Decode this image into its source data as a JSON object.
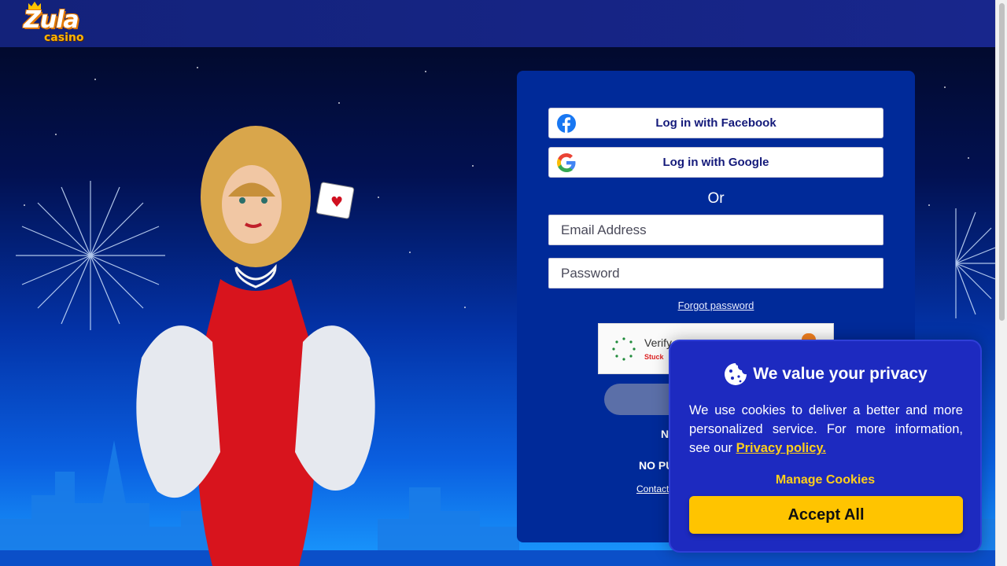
{
  "header": {
    "logo_main": "Zula",
    "logo_sub": "casino"
  },
  "login": {
    "facebook_label": "Log in with Facebook",
    "google_label": "Log in with Google",
    "or_text": "Or",
    "email_placeholder": "Email Address",
    "password_placeholder": "Password",
    "forgot_label": "Forgot password",
    "captcha_verify": "Verify",
    "captcha_stuck": "Stuck",
    "text_line1": "N",
    "text_line2": "NO PU",
    "contact_label": "Contact"
  },
  "cookie": {
    "title": "We value your privacy",
    "body_text": "We use cookies to deliver a better and more personalized service. For more information, see our ",
    "privacy_link": "Privacy policy.",
    "manage_label": "Manage Cookies",
    "accept_label": "Accept All"
  },
  "colors": {
    "header": "#13227a",
    "panel": "#002a99",
    "cookie_bg": "#1d2ac0",
    "accent_yellow": "#ffc400",
    "facebook_blue": "#1877f2"
  },
  "icons": {
    "facebook": "facebook-icon",
    "google": "google-icon",
    "cookie": "cookie-icon",
    "captcha_spinner": "spinner-icon"
  }
}
